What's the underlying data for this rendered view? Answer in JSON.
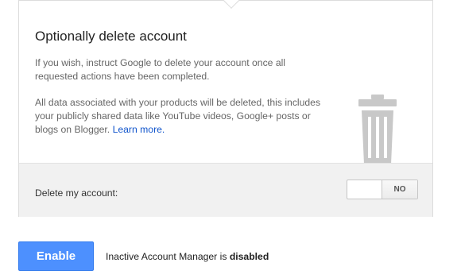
{
  "section": {
    "title": "Optionally delete account",
    "paragraph1": "If you wish, instruct Google to delete your account once all requested actions have been completed.",
    "paragraph2_text": "All data associated with your products will be deleted, this includes your publicly shared data like YouTube videos, Google+ posts or blogs on Blogger.",
    "learn_more_link": "Learn more.",
    "illustration_icon": "trash-can-icon"
  },
  "delete_option": {
    "label": "Delete my account:",
    "toggle_state": "NO"
  },
  "footer": {
    "enable_button_label": "Enable",
    "status_prefix": "Inactive Account Manager is",
    "status_value": "disabled"
  },
  "colors": {
    "primary_button": "#4d90fe",
    "link": "#1155cc",
    "panel_background": "#f1f1f1",
    "illustration": "#c8c8c8"
  }
}
